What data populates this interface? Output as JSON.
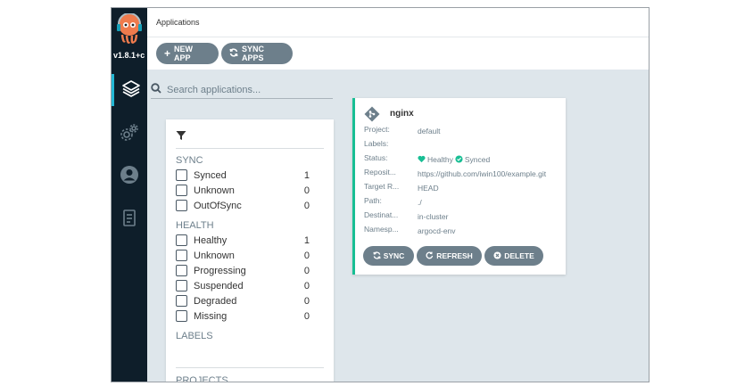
{
  "app": {
    "version": "v1.8.1+c",
    "title": "Applications"
  },
  "sidebar": {
    "items": [
      {
        "name": "applications",
        "icon": "layers-icon",
        "active": true
      },
      {
        "name": "settings",
        "icon": "gears-icon",
        "active": false
      },
      {
        "name": "user-info",
        "icon": "user-icon",
        "active": false
      },
      {
        "name": "documentation",
        "icon": "book-icon",
        "active": false
      }
    ]
  },
  "toolbar": {
    "new_app": "NEW APP",
    "sync_apps": "SYNC APPS"
  },
  "search": {
    "placeholder": "Search applications..."
  },
  "filters": {
    "sync": {
      "title": "SYNC",
      "items": [
        {
          "label": "Synced",
          "count": "1"
        },
        {
          "label": "Unknown",
          "count": "0"
        },
        {
          "label": "OutOfSync",
          "count": "0"
        }
      ]
    },
    "health": {
      "title": "HEALTH",
      "items": [
        {
          "label": "Healthy",
          "count": "1"
        },
        {
          "label": "Unknown",
          "count": "0"
        },
        {
          "label": "Progressing",
          "count": "0"
        },
        {
          "label": "Suspended",
          "count": "0"
        },
        {
          "label": "Degraded",
          "count": "0"
        },
        {
          "label": "Missing",
          "count": "0"
        }
      ]
    },
    "labels_title": "LABELS",
    "projects_title": "PROJECTS"
  },
  "card": {
    "name": "nginx",
    "fields": {
      "project": {
        "key": "Project:",
        "value": "default"
      },
      "labels": {
        "key": "Labels:",
        "value": ""
      },
      "status": {
        "key": "Status:",
        "health": "Healthy",
        "sync": "Synced"
      },
      "repo": {
        "key": "Reposit...",
        "value": "https://github.com/iwin100/example.git"
      },
      "target": {
        "key": "Target R...",
        "value": "HEAD"
      },
      "path": {
        "key": "Path:",
        "value": "./"
      },
      "destination": {
        "key": "Destinat...",
        "value": "in-cluster"
      },
      "namespace": {
        "key": "Namesp...",
        "value": "argocd-env"
      }
    },
    "buttons": {
      "sync": "SYNC",
      "refresh": "REFRESH",
      "delete": "DELETE"
    }
  },
  "colors": {
    "accent": "#18be94",
    "sidebar": "#0e1e2a",
    "button": "#6d7f8b",
    "background": "#dee6eb",
    "active_nav": "#24b8d4"
  }
}
